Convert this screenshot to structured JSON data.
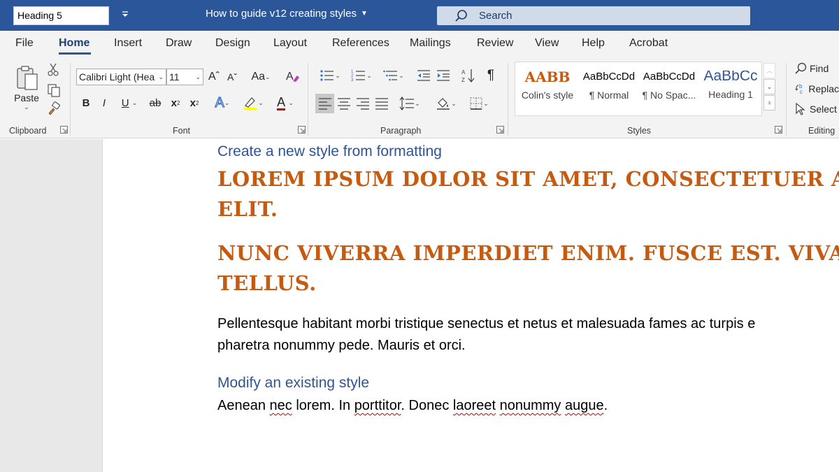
{
  "titlebar": {
    "style_box_value": "Heading 5",
    "document_title": "How to guide v12 creating styles",
    "search_label": "Search"
  },
  "tabs": [
    "File",
    "Home",
    "Insert",
    "Draw",
    "Design",
    "Layout",
    "References",
    "Mailings",
    "Review",
    "View",
    "Help",
    "Acrobat"
  ],
  "ribbon": {
    "clipboard": {
      "paste_label": "Paste",
      "group_label": "Clipboard"
    },
    "font": {
      "font_name": "Calibri Light (Hea",
      "font_size": "11",
      "change_case": "Aa",
      "bold": "B",
      "italic": "I",
      "underline": "U",
      "strikethrough": "ab",
      "subscript": "x",
      "superscript": "x",
      "text_effects": "A",
      "font_color": "A",
      "group_label": "Font"
    },
    "paragraph": {
      "group_label": "Paragraph"
    },
    "styles": {
      "items": [
        {
          "sample": "AABB",
          "name": "Colin's style"
        },
        {
          "sample": "AaBbCcDd",
          "name": "¶ Normal"
        },
        {
          "sample": "AaBbCcDd",
          "name": "¶ No Spac..."
        },
        {
          "sample": "AaBbCc",
          "name": "Heading 1"
        }
      ],
      "group_label": "Styles"
    },
    "editing": {
      "find": "Find",
      "replace": "Replac",
      "select": "Select",
      "group_label": "Editing"
    }
  },
  "document": {
    "heading1": "Create a new style from formatting",
    "orange1_line1": "LOREM IPSUM DOLOR SIT AMET, CONSECTETUER ADIP",
    "orange1_line2": "ELIT.",
    "orange2_line1": "NUNC VIVERRA IMPERDIET ENIM. FUSCE EST. VIVAMUS",
    "orange2_line2": "TELLUS.",
    "body1_line1": "Pellentesque habitant morbi tristique senectus et netus et malesuada fames ac turpis e",
    "body1_line2": "pharetra nonummy pede. Mauris et orci.",
    "heading2": "Modify an existing style",
    "body2": {
      "w1": "Aenean ",
      "w2": "nec",
      "w3": " lorem. In ",
      "w4": "porttitor",
      "w5": ". Donec ",
      "w6": "laoreet",
      "w7": " ",
      "w8": "nonummy",
      "w9": " ",
      "w10": "augue",
      "w11": "."
    }
  },
  "colors": {
    "titlebar": "#2b579a",
    "heading": "#2f5496",
    "orange_style": "#c55a11",
    "ribbon_bg": "#f3f3f3"
  }
}
